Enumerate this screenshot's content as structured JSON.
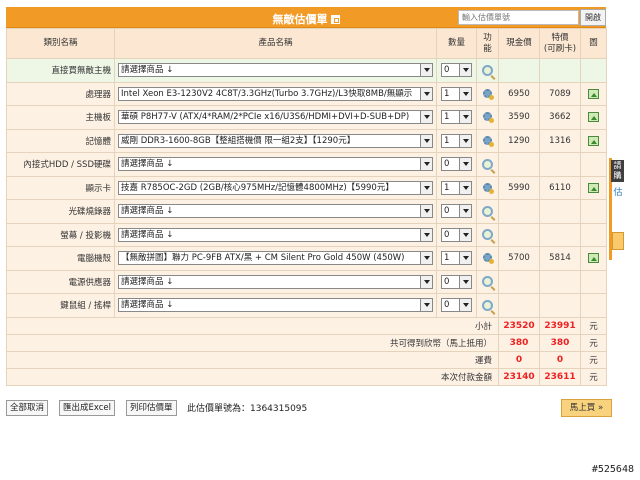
{
  "header": {
    "title": "無敵估價單",
    "search_placeholder": "輸入估價單號",
    "search_button": "開啟"
  },
  "columns": {
    "category": "類別名稱",
    "product": "產品名稱",
    "qty": "數量",
    "func": "功能",
    "cash_price": "現金價",
    "special_price_l1": "特價",
    "special_price_l2": "(可刷卡)",
    "image": "圖"
  },
  "rows": [
    {
      "category": "直接買無敵主機",
      "product": "請選擇商品 ↓",
      "qty": "0",
      "cash": "",
      "special": "",
      "icon": "zoom",
      "image": false
    },
    {
      "category": "處理器",
      "product": "Intel Xeon E3-1230V2 4C8T/3.3GHz(Turbo 3.7GHz)/L3快取8MB/無顯示",
      "qty": "1",
      "cash": "6950",
      "special": "7089",
      "icon": "gear",
      "image": true
    },
    {
      "category": "主機板",
      "product": "華碩 P8H77-V (ATX/4*RAM/2*PCIe x16/U3S6/HDMI+DVI+D-SUB+DP)",
      "qty": "1",
      "cash": "3590",
      "special": "3662",
      "icon": "gear",
      "image": true
    },
    {
      "category": "記憶體",
      "product": "威剛 DDR3-1600-8GB【整組搭機價 限一組2支】【1290元】",
      "qty": "1",
      "cash": "1290",
      "special": "1316",
      "icon": "gear",
      "image": true
    },
    {
      "category": "內接式HDD / SSD硬碟",
      "product": "請選擇商品 ↓",
      "qty": "0",
      "cash": "",
      "special": "",
      "icon": "zoom",
      "image": false
    },
    {
      "category": "顯示卡",
      "product": "技嘉 R785OC-2GD (2GB/核心975MHz/記憶體4800MHz)【5990元】",
      "qty": "1",
      "cash": "5990",
      "special": "6110",
      "icon": "gear",
      "image": true
    },
    {
      "category": "光碟燒錄器",
      "product": "請選擇商品 ↓",
      "qty": "0",
      "cash": "",
      "special": "",
      "icon": "zoom",
      "image": false
    },
    {
      "category": "螢幕 / 投影機",
      "product": "請選擇商品 ↓",
      "qty": "0",
      "cash": "",
      "special": "",
      "icon": "zoom",
      "image": false
    },
    {
      "category": "電腦機殼",
      "product": "【無敵拼圖】聯力 PC-9FB ATX/黑 + CM Silent Pro Gold 450W (450W)",
      "qty": "1",
      "cash": "5700",
      "special": "5814",
      "icon": "gear",
      "image": true
    },
    {
      "category": "電源供應器",
      "product": "請選擇商品 ↓",
      "qty": "0",
      "cash": "",
      "special": "",
      "icon": "zoom",
      "image": false
    },
    {
      "category": "鍵鼠組 / 搖桿",
      "product": "請選擇商品 ↓",
      "qty": "0",
      "cash": "",
      "special": "",
      "icon": "zoom",
      "image": false
    }
  ],
  "summary": [
    {
      "label": "小計",
      "cash": "23520",
      "special": "23991",
      "unit": "元"
    },
    {
      "label": "共可得到欣幣（馬上抵用）",
      "cash": "380",
      "special": "380",
      "unit": "元"
    },
    {
      "label": "運費",
      "cash": "0",
      "special": "0",
      "unit": "元"
    },
    {
      "label": "本次付款金額",
      "cash": "23140",
      "special": "23611",
      "unit": "元"
    }
  ],
  "footer": {
    "clear_button": "全部取消",
    "excel_button": "匯出成Excel",
    "print_button": "列印估價單",
    "quote_label": "此估價單號為：1364315095",
    "buy_button": "馬上買 »"
  },
  "side_tab": {
    "label1": "請購",
    "label2": "估"
  },
  "watermark": "#525648",
  "colors": {
    "header": "#f29a26",
    "row_bg": "#fdf1e4",
    "first_row_bg": "#eef6e6",
    "price_red": "#e22222"
  }
}
